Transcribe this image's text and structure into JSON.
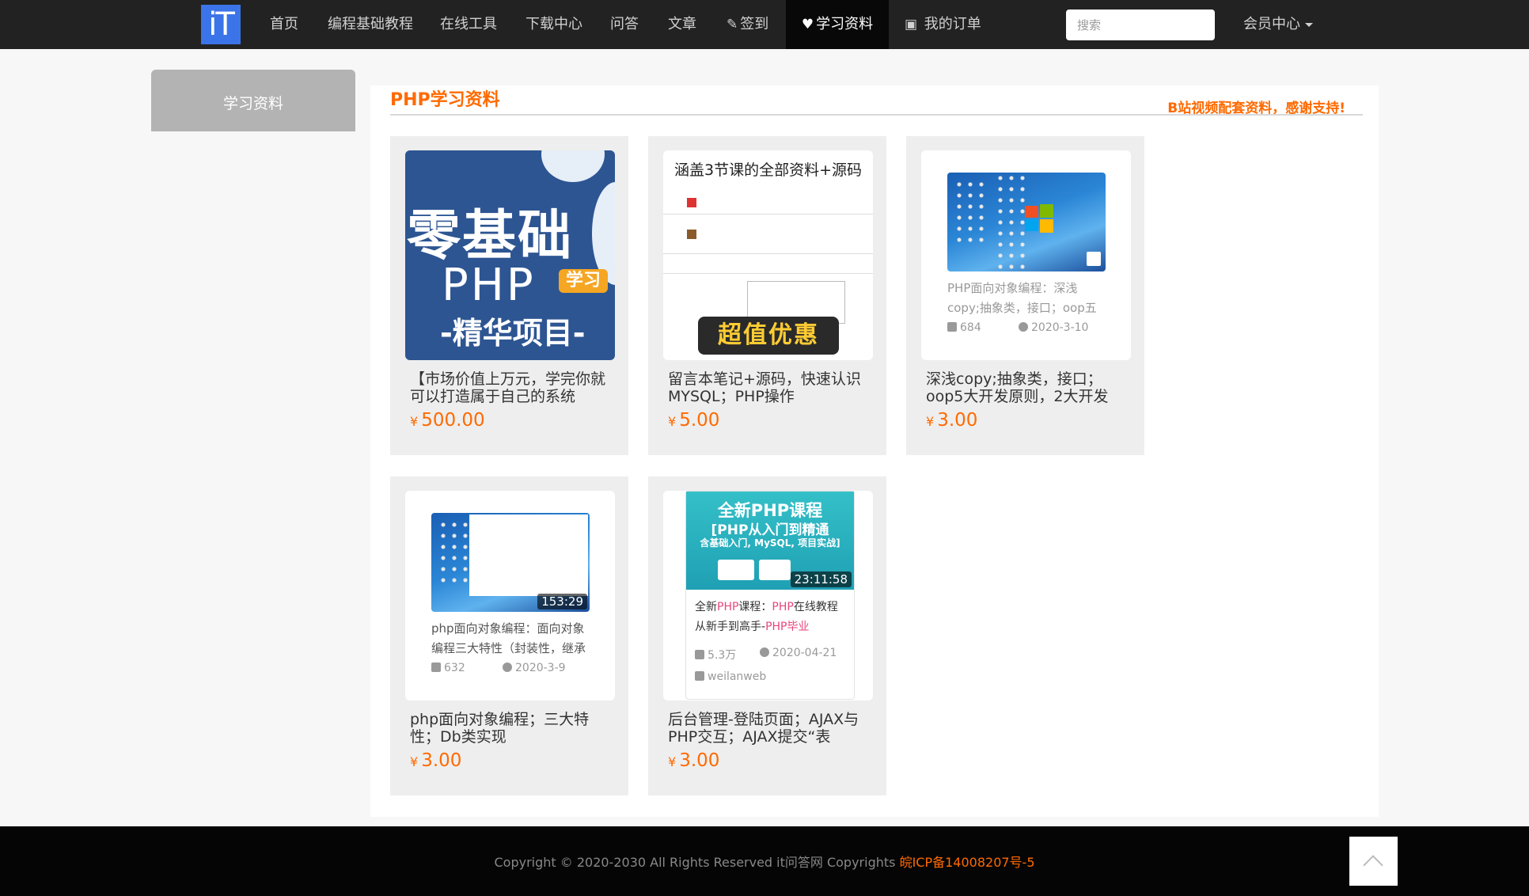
{
  "nav": {
    "logo": "iT",
    "items": [
      "首页",
      "编程基础教程",
      "在线工具",
      "下载中心",
      "问答",
      "文章",
      "签到",
      "学习资料",
      "我的订单"
    ],
    "search_placeholder": "搜索",
    "member": "会员中心",
    "icons": {
      "checkin": "edit-icon",
      "materials": "heart-icon",
      "orders": "shopping-bag-icon"
    }
  },
  "sidebar": {
    "items": [
      "学习资料"
    ]
  },
  "section": {
    "title": "PHP学习资料",
    "note": "B站视频配套资料，感谢支持!"
  },
  "currency": "¥",
  "products": [
    {
      "title": "【市场价值上万元，学完你就可以打造属于自己的系统",
      "price": "500.00",
      "thumb": {
        "big": "零基础",
        "php": "PHP",
        "tag": "学习",
        "sub": "-精华项目-"
      }
    },
    {
      "title": "留言本笔记+源码，快速认识MYSQL；PHP操作",
      "price": "5.00",
      "thumb": {
        "caption": "涵盖3节课的全部资料+源码",
        "badge": "超值优惠"
      }
    },
    {
      "title": "深浅copy;抽象类，接口；oop5大开发原则，2大开发",
      "price": "3.00",
      "thumb": {
        "desc": "PHP面向对象编程：深浅copy;抽象类，接口；oop五",
        "views": "684",
        "date": "2020-3-10"
      }
    },
    {
      "title": "php面向对象编程；三大特性；Db类实现",
      "price": "3.00",
      "thumb": {
        "desc": "php面向对象编程：面向对象编程三大特性（封装性，继承",
        "views": "632",
        "date": "2020-3-9",
        "duration": "153:29"
      }
    },
    {
      "title": "后台管理-登陆页面；AJAX与PHP交互；AJAX提交“表",
      "price": "3.00",
      "thumb": {
        "banner_title": "全新PHP课程",
        "banner_sub": "[PHP从入门到精通",
        "banner_small": "含基础入门, MySQL, 项目实战]",
        "duration": "23:11:58",
        "desc_a": "全新",
        "desc_b": "PHP",
        "desc_c": "课程：",
        "desc_d": "PHP",
        "desc_e": "在线教程从新手到高手-",
        "desc_f": "PHP毕业",
        "views": "5.3万",
        "date": "2020-04-21",
        "author": "weilanweb"
      }
    }
  ],
  "footer": {
    "copyright": "Copyright © 2020-2030 All Rights Reserved it问答网 Copyrights ",
    "icp": "皖ICP备14008207号-5"
  }
}
